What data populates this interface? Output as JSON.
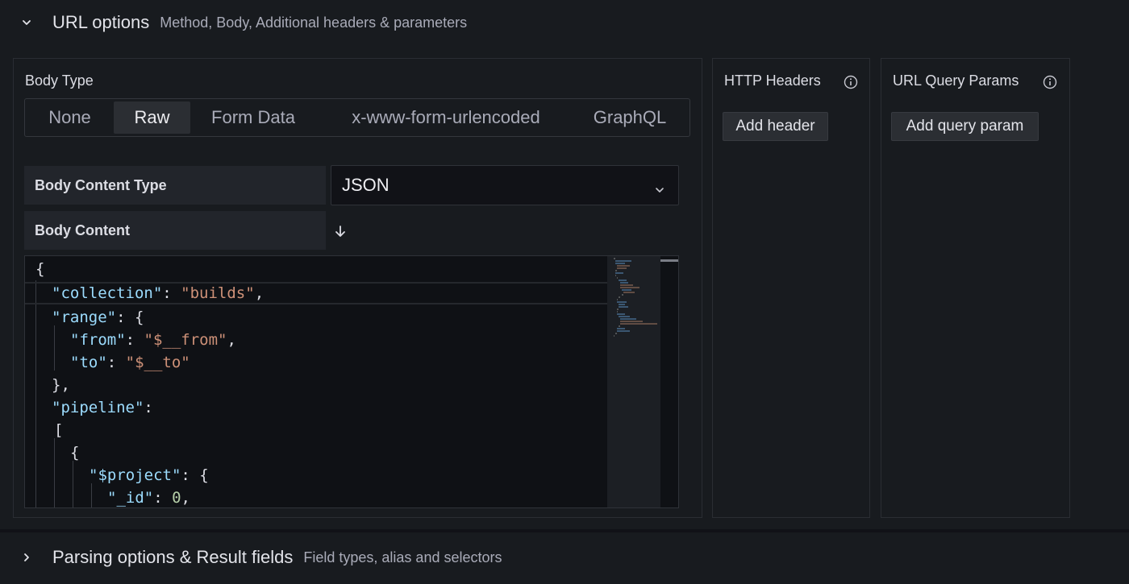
{
  "url_options": {
    "title": "URL options",
    "subtitle": "Method, Body, Additional headers & parameters"
  },
  "body": {
    "label": "Body Type",
    "types": [
      "None",
      "Raw",
      "Form Data",
      "x-www-form-urlencoded",
      "GraphQL"
    ],
    "selected_type": "Raw",
    "content_type_label": "Body Content Type",
    "content_type_value": "JSON",
    "content_label": "Body Content"
  },
  "editor": {
    "lines": [
      "{",
      "\"collection\": \"builds\",",
      "\"range\": {",
      "\"from\": \"$__from\",",
      "\"to\": \"$__to\"",
      "},",
      "\"pipeline\":",
      "[",
      "{",
      "\"$project\": {",
      "\"_id\": 0,"
    ]
  },
  "http_headers": {
    "title": "HTTP Headers",
    "add_label": "Add header"
  },
  "query_params": {
    "title": "URL Query Params",
    "add_label": "Add query param"
  },
  "parsing_options": {
    "title": "Parsing options & Result fields",
    "subtitle": "Field types, alias and selectors"
  },
  "colors": {
    "background": "#181b1f",
    "key": "#9cdcfe",
    "string": "#ce9178",
    "number": "#b5cea8"
  },
  "icons": [
    "chevron-down-icon",
    "chevron-right-icon",
    "info-icon",
    "download-arrow-icon"
  ]
}
